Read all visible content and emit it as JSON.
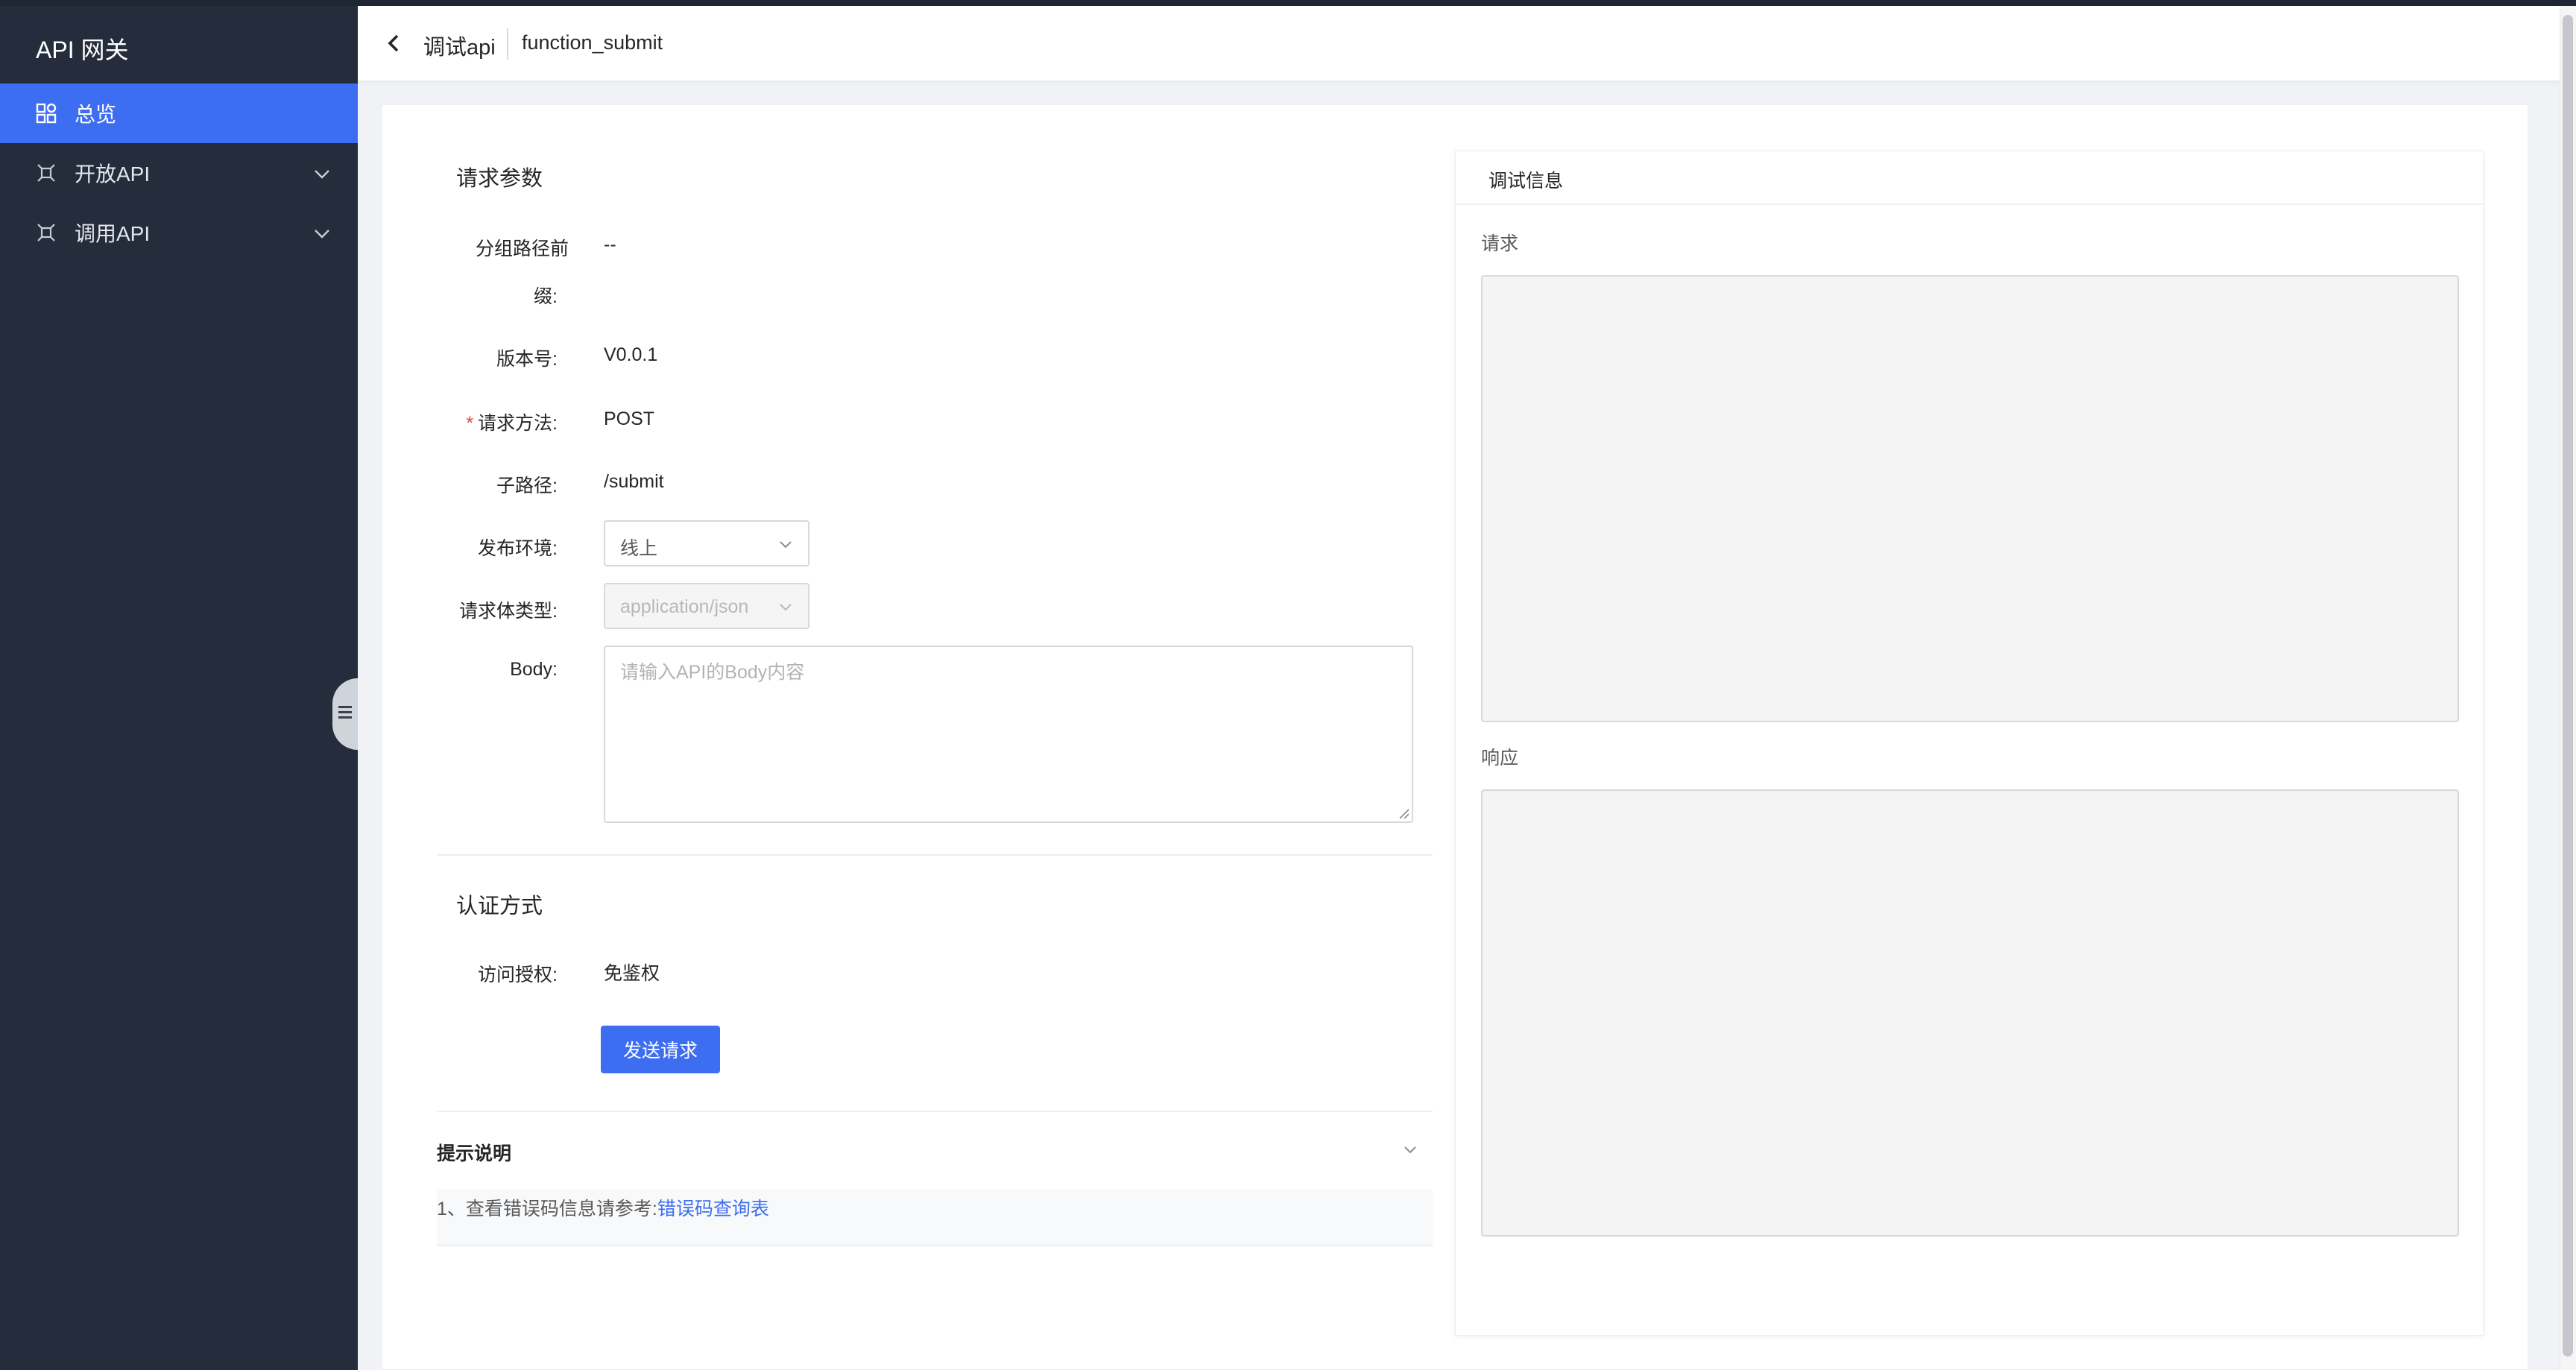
{
  "app": {
    "brand": "API 网关"
  },
  "sidebar": {
    "items": [
      {
        "label": "总览",
        "icon": "dashboard-icon",
        "active": true
      },
      {
        "label": "开放API",
        "icon": "api-icon",
        "expandable": true
      },
      {
        "label": "调用API",
        "icon": "api-icon",
        "expandable": true
      }
    ]
  },
  "header": {
    "title": "调试api",
    "subtitle": "function_submit"
  },
  "request_params": {
    "section_title": "请求参数",
    "group_prefix": {
      "label_line1": "分组路径前",
      "label_line2": "缀:",
      "value": "--"
    },
    "version": {
      "label": "版本号:",
      "value": "V0.0.1"
    },
    "method": {
      "required_mark": "*",
      "label": "请求方法:",
      "value": "POST"
    },
    "subpath": {
      "label": "子路径:",
      "value": "/submit"
    },
    "env": {
      "label": "发布环境:",
      "value": "线上"
    },
    "body_type": {
      "label": "请求体类型:",
      "value": "application/json"
    },
    "body": {
      "label": "Body:",
      "placeholder": "请输入API的Body内容"
    }
  },
  "auth": {
    "section_title": "认证方式",
    "access": {
      "label": "访问授权:",
      "value": "免鉴权"
    },
    "send_button": "发送请求"
  },
  "tips": {
    "title": "提示说明",
    "text": "1、查看错误码信息请参考:",
    "link": "错误码查询表"
  },
  "debug_panel": {
    "title": "调试信息",
    "request_label": "请求",
    "response_label": "响应"
  },
  "colors": {
    "primary": "#3d6df0",
    "sidebar_bg": "#252c3b",
    "required": "#e8413c"
  }
}
